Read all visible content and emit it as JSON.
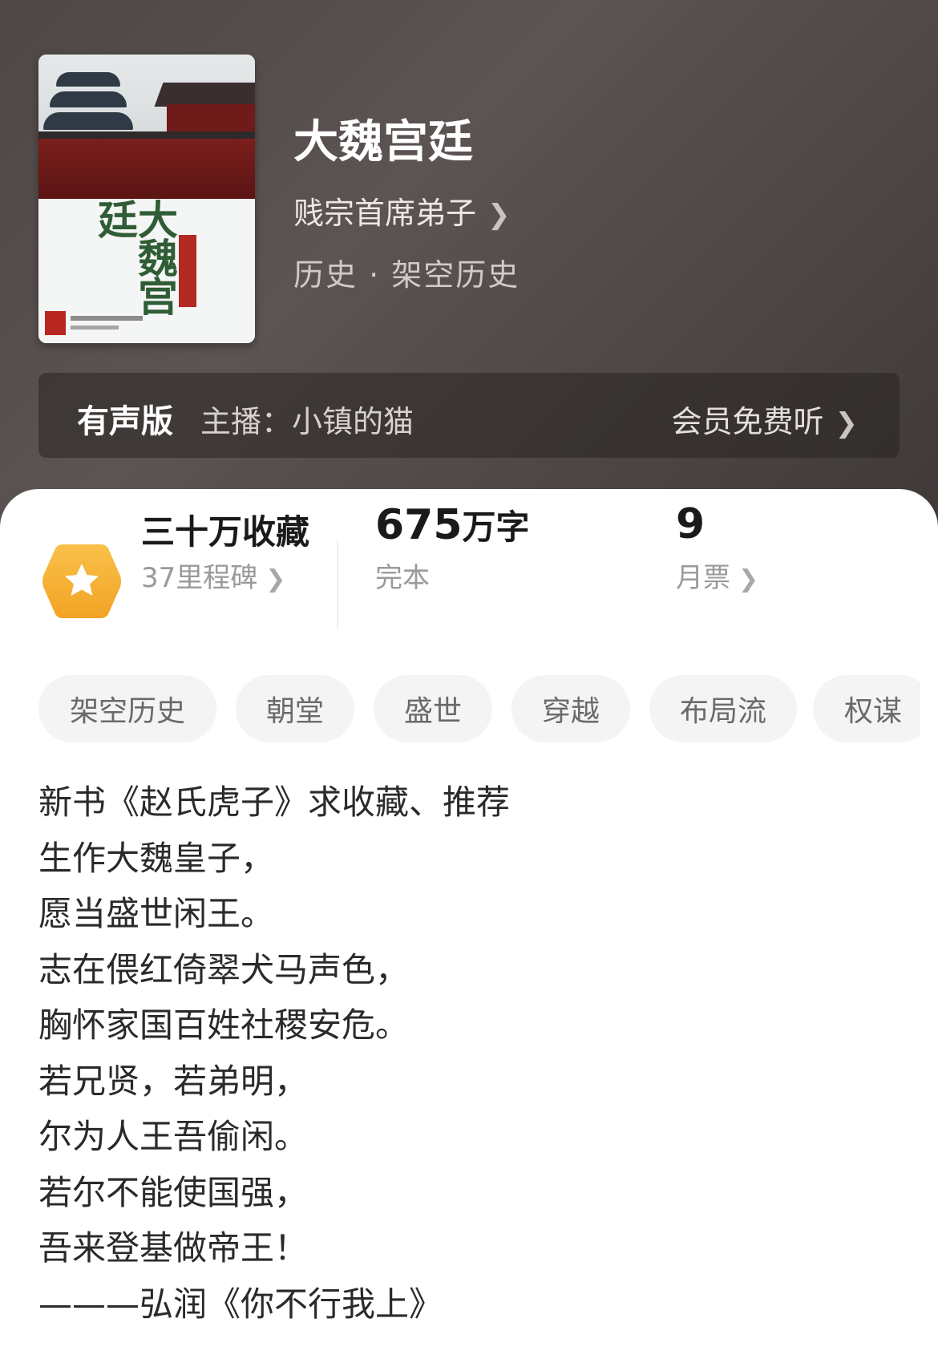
{
  "book": {
    "title": "大魏宫廷",
    "author": "贱宗首席弟子",
    "genre": "历史 · 架空历史",
    "cover_title": "大魏宫廷"
  },
  "audio": {
    "label": "有声版",
    "host": "主播：小镇的猫",
    "action": "会员免费听"
  },
  "stats": {
    "collection_title": "三十万收藏",
    "milestones": "37里程碑",
    "word_count_number": "675",
    "word_count_unit": "万字",
    "status": "完本",
    "monthly_votes": "9",
    "monthly_votes_label": "月票"
  },
  "tags": [
    "架空历史",
    "朝堂",
    "盛世",
    "穿越",
    "布局流",
    "权谋"
  ],
  "description": [
    "新书《赵氏虎子》求收藏、推荐",
    "生作大魏皇子，",
    "愿当盛世闲王。",
    "志在偎红倚翠犬马声色，",
    "胸怀家国百姓社稷安危。",
    "若兄贤，若弟明，",
    "尔为人王吾偷闲。",
    "若尔不能使国强，",
    "吾来登基做帝王！",
    "———弘润《你不行我上》"
  ],
  "colors": {
    "header_bg": "#4e4745",
    "badge_orange": "#f5a623",
    "tag_bg": "#f4f4f4"
  },
  "icons": {
    "chevron": "chevron-right-icon",
    "badge": "star-hexagon-icon"
  }
}
